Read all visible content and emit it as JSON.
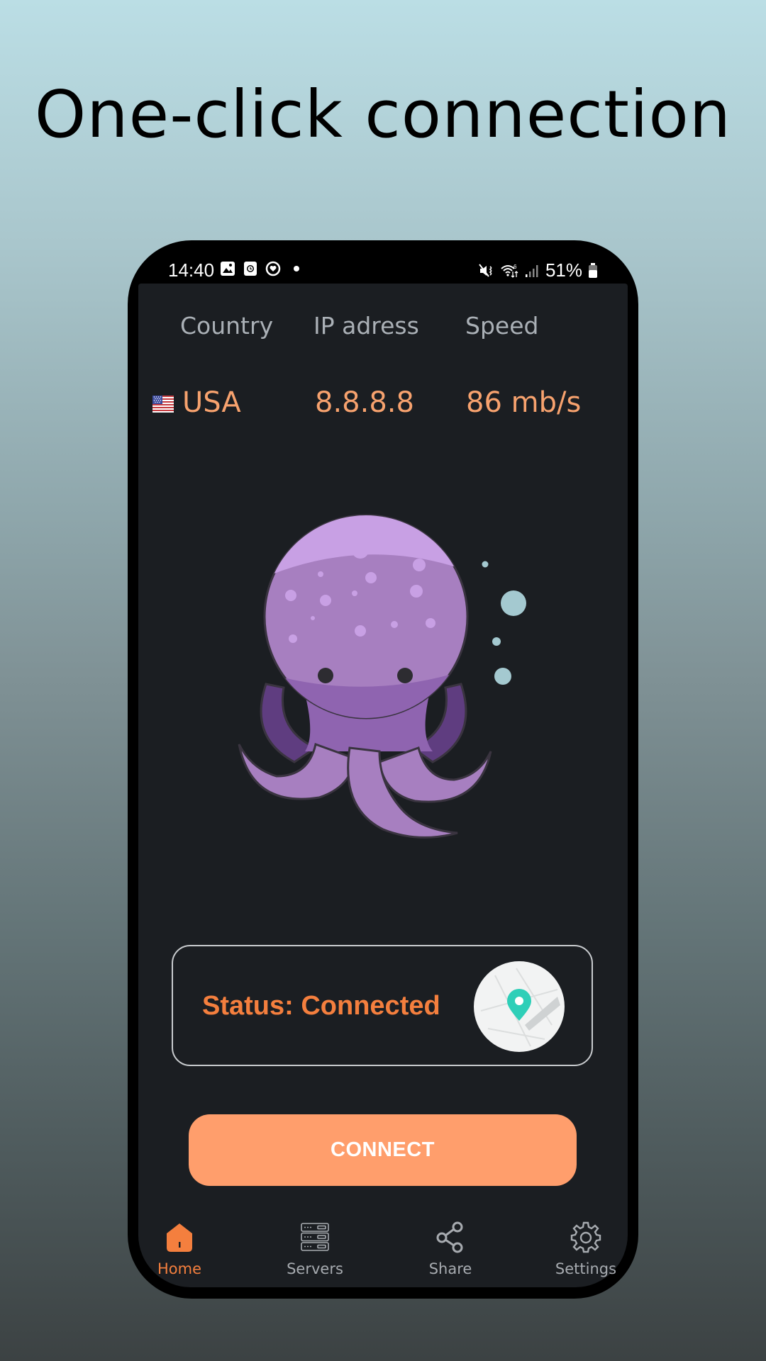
{
  "headline": "One-click connection",
  "status_bar": {
    "time": "14:40",
    "left_icons": [
      "gallery-icon",
      "screen-record-icon",
      "health-icon",
      "notification-dot"
    ],
    "right_icons": [
      "mute-vibrate-icon",
      "wifi-6-icon",
      "signal-icon",
      "battery-icon"
    ],
    "battery": "51%"
  },
  "info": {
    "headers": {
      "country": "Country",
      "ip": "IP adress",
      "speed": "Speed"
    },
    "values": {
      "country": "USA",
      "ip": "8.8.8.8",
      "speed": "86 mb/s"
    },
    "flag": "us-flag"
  },
  "status": {
    "label": "Status: Connected",
    "map_icon": "map-location-pin"
  },
  "connect_button": "CONNECT",
  "nav": [
    {
      "label": "Home",
      "icon": "home-icon",
      "active": true
    },
    {
      "label": "Servers",
      "icon": "servers-icon",
      "active": false
    },
    {
      "label": "Share",
      "icon": "share-icon",
      "active": false
    },
    {
      "label": "Settings",
      "icon": "settings-gear-icon",
      "active": false
    }
  ],
  "colors": {
    "accent": "#f47f3e",
    "button": "#ff9e6c",
    "value_text": "#f7a26e",
    "screen_bg": "#1b1e22",
    "octopus": "#a77fc0",
    "bubbles": "#a4c9d0",
    "pin": "#2ecfb8"
  }
}
